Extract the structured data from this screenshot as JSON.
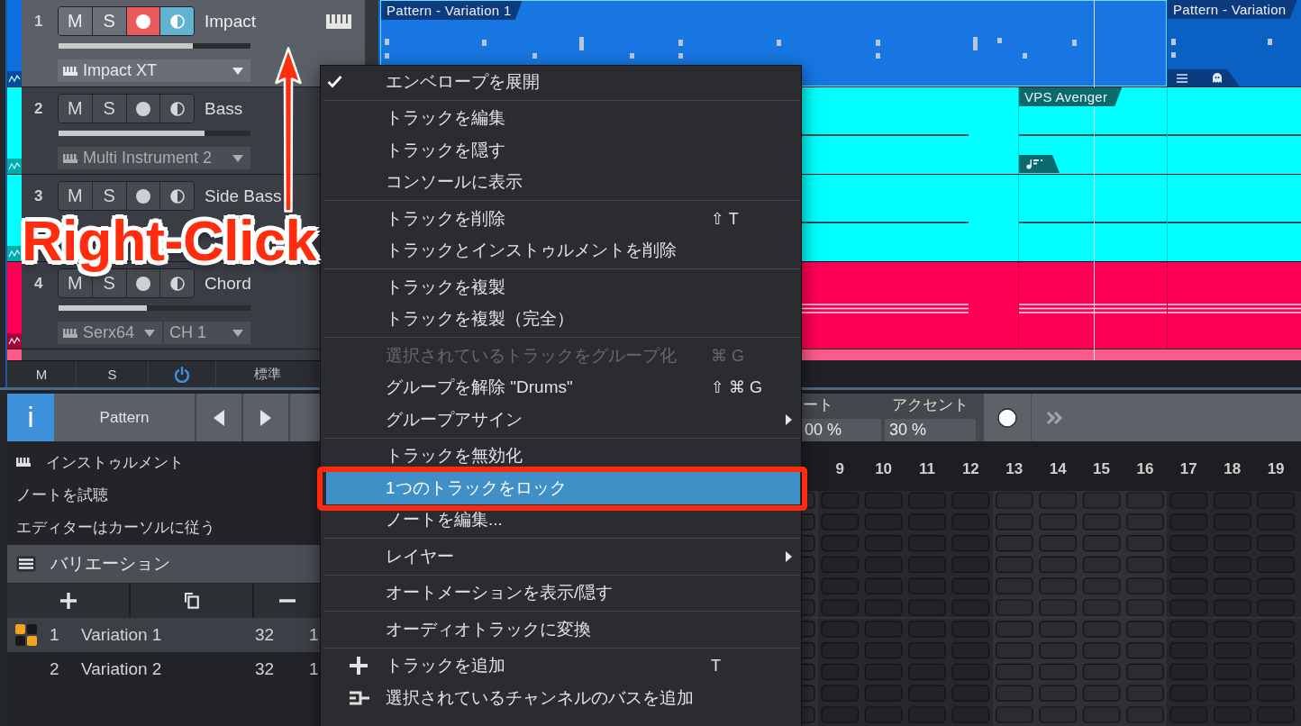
{
  "tracks": [
    {
      "number": "1",
      "name": "Impact",
      "color": "#0b6fe0",
      "selected": true,
      "mute_label": "M",
      "muted": false,
      "solo_label": "S",
      "soloed": false,
      "armed": true,
      "monitoring": true,
      "level": 0.7,
      "instrument": "Impact XT",
      "clips": [
        {
          "kind": "pattern",
          "label": "Pattern - Variation 1",
          "selected": true,
          "tab": false
        },
        {
          "kind": "pattern",
          "label": "Pattern - Variation",
          "selected": false,
          "tab": true
        }
      ]
    },
    {
      "number": "2",
      "name": "Bass",
      "color": "#00ffff",
      "selected": false,
      "mute_label": "M",
      "muted": false,
      "solo_label": "S",
      "soloed": false,
      "armed": false,
      "monitoring": false,
      "level": 0.76,
      "instrument": "Multi Instrument 2",
      "clips": [
        {
          "kind": "notes",
          "selected": false,
          "tab": false
        },
        {
          "kind": "notes",
          "label": "VPS Avenger",
          "selected": false,
          "tab": true
        },
        {
          "kind": "notes",
          "selected": false,
          "tab": false
        }
      ]
    },
    {
      "number": "3",
      "name": "Side Bass",
      "color": "#00ffff",
      "selected": false,
      "mute_label": "M",
      "muted": false,
      "solo_label": "S",
      "soloed": false,
      "armed": false,
      "monitoring": false,
      "clips": [
        {
          "kind": "notes",
          "selected": false,
          "tab": false
        },
        {
          "kind": "notes",
          "selected": false,
          "tab": false
        },
        {
          "kind": "notes",
          "selected": false,
          "tab": false
        }
      ]
    },
    {
      "number": "4",
      "name": "Chord",
      "color": "#ff0055",
      "selected": false,
      "mute_label": "M",
      "muted": false,
      "solo_label": "S",
      "soloed": false,
      "armed": false,
      "monitoring": false,
      "level": 0.46,
      "instrument": "Serx64",
      "channel": "CH 1",
      "clips": [
        {
          "kind": "chord",
          "selected": false,
          "tab": false
        },
        {
          "kind": "chord",
          "selected": false,
          "tab": false
        },
        {
          "kind": "chord",
          "selected": false,
          "tab": false
        }
      ]
    },
    {
      "color": "#ff5a8c",
      "selected": false
    }
  ],
  "track_footer": {
    "mute_label": "M",
    "solo_label": "S",
    "view_label": "標準"
  },
  "left_panel": {
    "info_label": "i",
    "mode_label": "Pattern",
    "options": [
      {
        "kind": "instrument",
        "label": "インストゥルメント"
      },
      {
        "kind": "plain",
        "label": "ノートを試聴"
      },
      {
        "kind": "plain",
        "label": "エディターはカーソルに従う"
      }
    ],
    "variations_title": "バリエーション",
    "variations": [
      {
        "number": "1",
        "name": "Variation 1",
        "length": "32",
        "column_4": "1",
        "selected": true
      },
      {
        "number": "2",
        "name": "Variation 2",
        "length": "32",
        "column_4": "1",
        "selected": false
      }
    ]
  },
  "pattern_editor": {
    "gate": {
      "label": "ート",
      "value": "00 %"
    },
    "accent": {
      "label": "アクセント",
      "value": "30 %"
    },
    "steps": [
      "9",
      "10",
      "11",
      "12",
      "13",
      "14",
      "15",
      "16",
      "17",
      "18",
      "19"
    ]
  },
  "context_menu": {
    "sections": [
      {
        "items": [
          {
            "label": "エンベロープを展開",
            "kind": "plain",
            "checked": true,
            "disabled": false,
            "selected": false
          }
        ]
      },
      {
        "items": [
          {
            "label": "トラックを編集",
            "kind": "plain",
            "checked": false,
            "disabled": false,
            "selected": false
          },
          {
            "label": "トラックを隠す",
            "kind": "plain",
            "checked": false,
            "disabled": false,
            "selected": false
          },
          {
            "label": "コンソールに表示",
            "kind": "plain",
            "checked": false,
            "disabled": false,
            "selected": false
          }
        ]
      },
      {
        "items": [
          {
            "label": "トラックを削除",
            "kind": "plain",
            "shortcut": "⇧ T",
            "checked": false,
            "disabled": false,
            "selected": false
          },
          {
            "label": "トラックとインストゥルメントを削除",
            "kind": "plain",
            "checked": false,
            "disabled": false,
            "selected": false
          }
        ]
      },
      {
        "items": [
          {
            "label": "トラックを複製",
            "kind": "plain",
            "checked": false,
            "disabled": false,
            "selected": false
          },
          {
            "label": "トラックを複製（完全）",
            "kind": "plain",
            "checked": false,
            "disabled": false,
            "selected": false
          }
        ]
      },
      {
        "items": [
          {
            "label": "選択されているトラックをグループ化",
            "kind": "plain",
            "shortcut": "⌘ G",
            "checked": false,
            "disabled": true,
            "selected": false
          },
          {
            "label": "グループを解除 \"Drums\"",
            "kind": "plain",
            "shortcut": "⇧ ⌘ G",
            "checked": false,
            "disabled": false,
            "selected": false
          },
          {
            "label": "グループアサイン",
            "kind": "submenu",
            "checked": false,
            "disabled": false,
            "selected": false
          }
        ]
      },
      {
        "items": [
          {
            "label": "トラックを無効化",
            "kind": "plain",
            "checked": false,
            "disabled": false,
            "selected": false
          },
          {
            "label": "1つのトラックをロック",
            "kind": "plain",
            "checked": false,
            "disabled": false,
            "selected": true
          },
          {
            "label": "ノートを編集...",
            "kind": "plain",
            "checked": false,
            "disabled": false,
            "selected": false
          }
        ]
      },
      {
        "items": [
          {
            "label": "レイヤー",
            "kind": "submenu",
            "checked": false,
            "disabled": false,
            "selected": false
          }
        ]
      },
      {
        "items": [
          {
            "label": "オートメーションを表示/隠す",
            "kind": "plain",
            "checked": false,
            "disabled": false,
            "selected": false
          }
        ]
      },
      {
        "items": [
          {
            "label": "オーディオトラックに変換",
            "kind": "plain",
            "checked": false,
            "disabled": false,
            "selected": false
          }
        ]
      },
      {
        "items": [
          {
            "label": "トラックを追加",
            "kind": "add",
            "shortcut": "T",
            "checked": false,
            "disabled": false,
            "selected": false
          },
          {
            "label": "選択されているチャンネルのバスを追加",
            "kind": "bus",
            "checked": false,
            "disabled": false,
            "selected": false
          }
        ]
      }
    ]
  },
  "annotation": {
    "label": "Right-Click",
    "arrow": true
  }
}
